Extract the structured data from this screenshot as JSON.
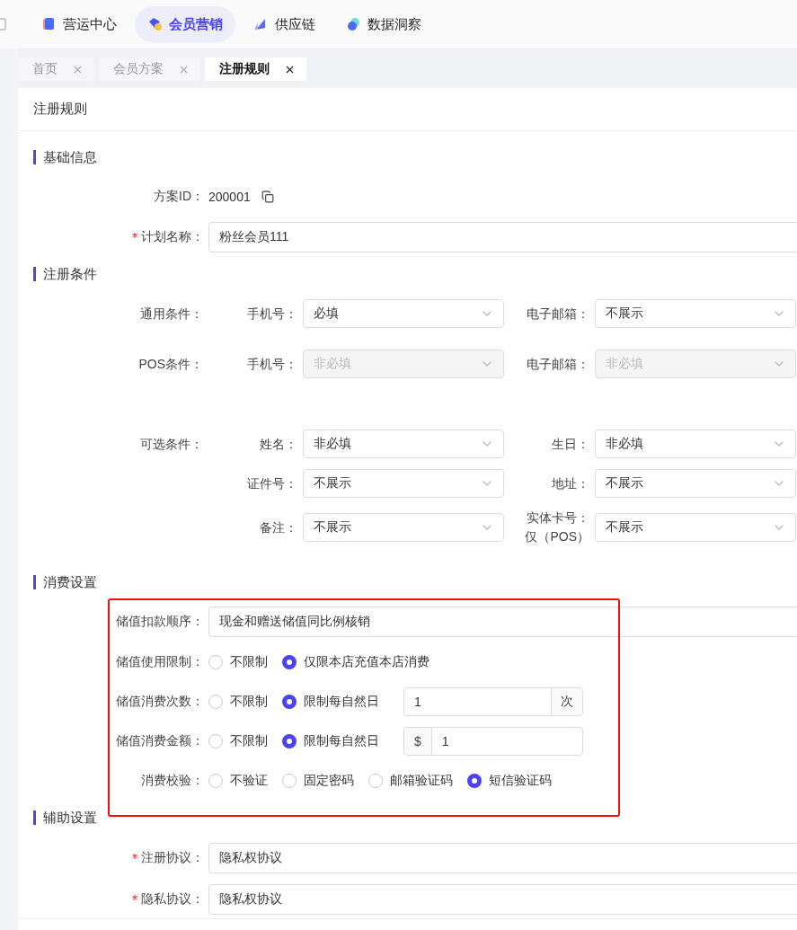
{
  "nav": {
    "items": [
      {
        "label": "营运中心",
        "kind": "cube",
        "selected": false
      },
      {
        "label": "会员营销",
        "kind": "diamond",
        "selected": true
      },
      {
        "label": "供应链",
        "kind": "flag",
        "selected": false
      },
      {
        "label": "数据洞察",
        "kind": "orb",
        "selected": false
      }
    ]
  },
  "tabs": [
    {
      "label": "首页",
      "selected": false
    },
    {
      "label": "会员方案",
      "selected": false
    },
    {
      "label": "注册规则",
      "selected": true
    }
  ],
  "card_title": "注册规则",
  "sections": [
    {
      "title": "基础信息",
      "highlighted": false,
      "rows": [
        {
          "kind": "text",
          "label": "方案ID：",
          "value": "200001"
        },
        {
          "kind": "input",
          "label": "计划名称：",
          "required": true,
          "value": "粉丝会员111"
        }
      ]
    },
    {
      "title": "注册条件",
      "highlighted": false,
      "rows": [
        {
          "kind": "selects",
          "label": "通用条件：",
          "fields": [
            {
              "label": "手机号：",
              "value": "必填",
              "disabled": false
            },
            {
              "label": "电子邮箱：",
              "value": "不展示",
              "disabled": false
            }
          ]
        },
        {
          "kind": "selects",
          "label": "POS条件：",
          "fields": [
            {
              "label": "手机号：",
              "value": "非必填",
              "disabled": true
            },
            {
              "label": "电子邮箱：",
              "value": "非必填",
              "disabled": true
            }
          ]
        },
        {
          "kind": "selects",
          "label": "可选条件：",
          "fields": [
            {
              "label": "姓名：",
              "value": "非必填",
              "disabled": false
            },
            {
              "label": "生日：",
              "value": "非必填",
              "disabled": false
            }
          ]
        },
        {
          "kind": "selects",
          "fields": [
            {
              "label": "证件号：",
              "value": "不展示",
              "disabled": false
            },
            {
              "label": "地址：",
              "value": "不展示",
              "disabled": false
            }
          ]
        },
        {
          "kind": "selects",
          "fields": [
            {
              "label": "备注：",
              "value": "不展示",
              "disabled": false
            },
            {
              "label": "实体卡号：仅（POS）",
              "value": "不展示",
              "disabled": false
            }
          ]
        }
      ]
    },
    {
      "title": "消费设置",
      "highlighted": true,
      "rows": [
        {
          "kind": "input",
          "label": "储值扣款顺序：",
          "required": false,
          "value": "现金和赠送储值同比例核销"
        },
        {
          "kind": "radios",
          "label": "储值使用限制：",
          "options": [
            {
              "label": "不限制",
              "selected": false
            },
            {
              "label": "仅限本店充值本店消费",
              "selected": true
            }
          ]
        },
        {
          "kind": "radios",
          "label": "储值消费次数：",
          "options": [
            {
              "label": "不限制",
              "selected": false
            },
            {
              "label": "限制每自然日",
              "selected": true
            }
          ],
          "addon": {
            "kind": "suffix",
            "text": "次",
            "value": "1"
          }
        },
        {
          "kind": "radios",
          "label": "储值消费金额：",
          "options": [
            {
              "label": "不限制",
              "selected": false
            },
            {
              "label": "限制每自然日",
              "selected": true
            }
          ],
          "addon": {
            "kind": "prefix",
            "text": "$",
            "value": "1"
          }
        },
        {
          "kind": "radios",
          "label": "消费校验：",
          "options": [
            {
              "label": "不验证",
              "selected": false
            },
            {
              "label": "固定密码",
              "selected": false
            },
            {
              "label": "邮箱验证码",
              "selected": false
            },
            {
              "label": "短信验证码",
              "selected": true
            }
          ]
        }
      ]
    },
    {
      "title": "辅助设置",
      "highlighted": false,
      "rows": [
        {
          "kind": "input",
          "label": "注册协议：",
          "required": true,
          "value": "隐私权协议"
        },
        {
          "kind": "input",
          "label": "隐私协议：",
          "required": true,
          "value": "隐私权协议"
        }
      ]
    }
  ]
}
